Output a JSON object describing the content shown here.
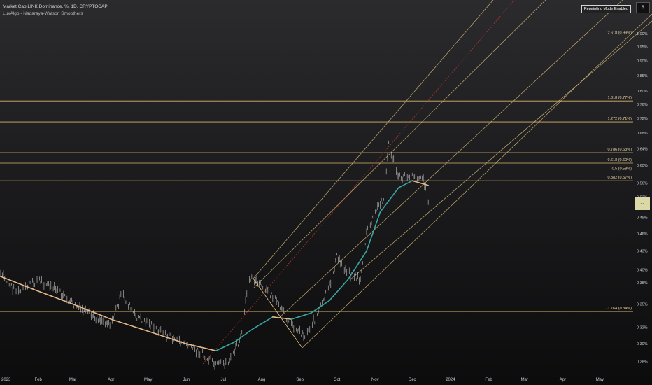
{
  "header": {
    "title": "Market Cap LINK Dominance, %, 1D, CRYPTOCAP",
    "indicator": "LuxAlgo - Nadaraya-Watson Smoothers",
    "repaint_badge": "Repainting Mode Enabled",
    "scale_button": "$",
    "price_tag": "- -"
  },
  "colors": {
    "fib_line": "#d8b36a",
    "channel_line": "#e2c37c",
    "mid_line": "#c0392b",
    "smoother_down": "#e8b98a",
    "smoother_up": "#3aa6a3",
    "candles": "#c8c8c8",
    "axis_text": "#c9ccd3"
  },
  "chart_data": {
    "type": "line",
    "title": "Market Cap LINK Dominance, %, 1D, CRYPTOCAP",
    "xlabel": "",
    "ylabel": "",
    "y_axis_scale": "log",
    "ylim": [
      0.27,
      1.05
    ],
    "x_ticks": [
      "2023",
      "Feb",
      "Mar",
      "Apr",
      "May",
      "Jun",
      "Jul",
      "Aug",
      "Sep",
      "Oct",
      "Nov",
      "Dec",
      "2024",
      "Feb",
      "Mar",
      "Apr",
      "May"
    ],
    "y_ticks": [
      "1.00%",
      "0.95%",
      "0.90%",
      "0.85%",
      "0.80%",
      "0.76%",
      "0.72%",
      "0.68%",
      "0.64%",
      "0.60%",
      "0.56%",
      "0.53%",
      "0.49%",
      "0.46%",
      "0.43%",
      "0.40%",
      "0.38%",
      "0.35%",
      "0.32%",
      "0.30%",
      "0.28%"
    ],
    "fib_levels": [
      {
        "label": "2.618 (0.99%)",
        "value": 0.99
      },
      {
        "label": "1.618 (0.77%)",
        "value": 0.77
      },
      {
        "label": "1.272 (0.71%)",
        "value": 0.71
      },
      {
        "label": "0.786 (0.63%)",
        "value": 0.63
      },
      {
        "label": "0.618 (0.60%)",
        "value": 0.605
      },
      {
        "label": "0.5 (0.58%)",
        "value": 0.585
      },
      {
        "label": "0.382 (0.57%)",
        "value": 0.565
      },
      {
        "label": "-1.764 (0.34%)",
        "value": 0.34
      }
    ],
    "last_price_line": 0.52,
    "series": [
      {
        "kind": "price",
        "x": [
          "2023-01-01",
          "2023-01-15",
          "2023-02-01",
          "2023-02-15",
          "2023-03-01",
          "2023-03-15",
          "2023-04-01",
          "2023-04-10",
          "2023-04-20",
          "2023-05-01",
          "2023-05-15",
          "2023-06-01",
          "2023-06-12",
          "2023-06-25",
          "2023-07-05",
          "2023-07-15",
          "2023-07-22",
          "2023-08-01",
          "2023-08-10",
          "2023-08-20",
          "2023-08-28",
          "2023-09-05",
          "2023-09-15",
          "2023-09-25",
          "2023-10-01",
          "2023-10-10",
          "2023-10-20",
          "2023-10-25",
          "2023-11-01",
          "2023-11-08",
          "2023-11-12",
          "2023-11-20",
          "2023-12-01",
          "2023-12-10",
          "2023-12-14"
        ],
        "values": [
          0.395,
          0.365,
          0.385,
          0.37,
          0.35,
          0.335,
          0.325,
          0.365,
          0.335,
          0.325,
          0.31,
          0.3,
          0.29,
          0.275,
          0.28,
          0.305,
          0.39,
          0.375,
          0.36,
          0.335,
          0.32,
          0.31,
          0.335,
          0.375,
          0.42,
          0.395,
          0.385,
          0.46,
          0.5,
          0.53,
          0.65,
          0.57,
          0.58,
          0.57,
          0.52
        ]
      },
      {
        "kind": "smoother",
        "x": [
          "2023-01-01",
          "2023-02-01",
          "2023-03-01",
          "2023-04-01",
          "2023-05-01",
          "2023-06-01",
          "2023-06-25",
          "2023-07-10",
          "2023-07-25",
          "2023-08-10",
          "2023-08-25",
          "2023-09-10",
          "2023-09-25",
          "2023-10-10",
          "2023-10-25",
          "2023-11-05",
          "2023-11-20",
          "2023-12-01",
          "2023-12-14"
        ],
        "values": [
          0.39,
          0.368,
          0.35,
          0.33,
          0.315,
          0.3,
          0.292,
          0.302,
          0.318,
          0.333,
          0.33,
          0.338,
          0.355,
          0.385,
          0.43,
          0.5,
          0.55,
          0.565,
          0.555
        ]
      }
    ]
  }
}
